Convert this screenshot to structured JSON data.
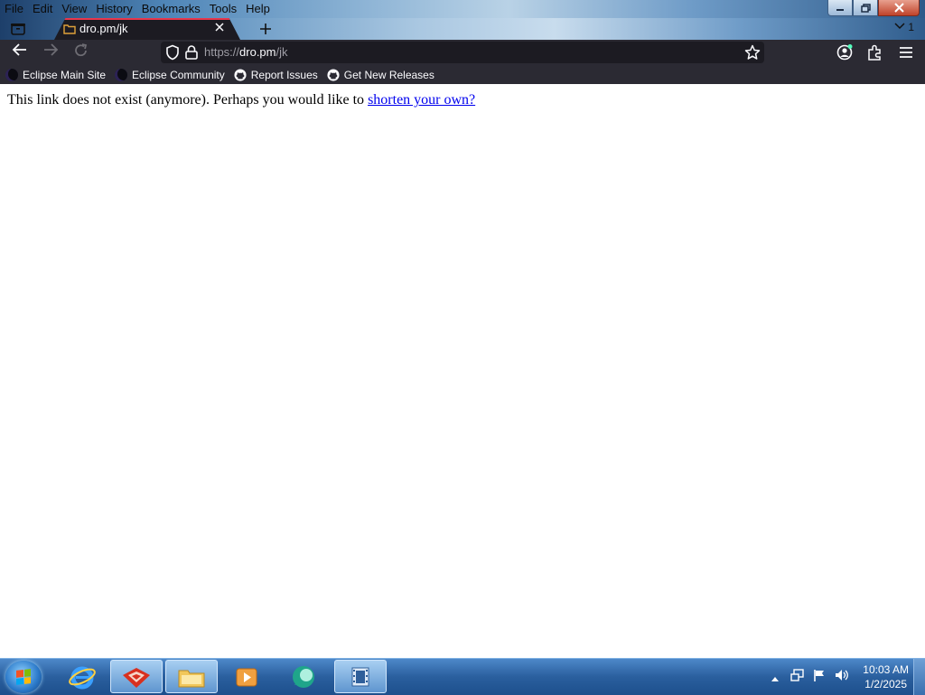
{
  "menu": {
    "items": [
      "File",
      "Edit",
      "View",
      "History",
      "Bookmarks",
      "Tools",
      "Help"
    ]
  },
  "window_controls": {
    "minimize_icon": "minimize-icon",
    "restore_icon": "restore-icon",
    "close_icon": "close-icon"
  },
  "tabs": {
    "active_title": "dro.pm/jk",
    "count_label": "1"
  },
  "urlbar": {
    "scheme": "https://",
    "host": "dro.pm",
    "path": "/jk"
  },
  "bookmarks": [
    {
      "label": "Eclipse Main Site",
      "icon": "eclipse-icon"
    },
    {
      "label": "Eclipse Community",
      "icon": "eclipse-icon"
    },
    {
      "label": "Report Issues",
      "icon": "github-icon"
    },
    {
      "label": "Get New Releases",
      "icon": "github-icon"
    }
  ],
  "page": {
    "message": "This link does not exist (anymore). Perhaps you would like to ",
    "link_text": "shorten your own?"
  },
  "taskbar": {
    "apps": [
      "internet-explorer-icon",
      "app-red-icon",
      "file-explorer-icon",
      "media-player-icon",
      "chat-app-icon",
      "video-app-icon"
    ],
    "clock_time": "10:03 AM",
    "clock_date": "1/2/2025"
  },
  "colors": {
    "tab_accent": "#e8374c",
    "toolbar_bg": "#2b2a33",
    "urlbar_bg": "#1c1b22",
    "link": "#0000ee"
  }
}
